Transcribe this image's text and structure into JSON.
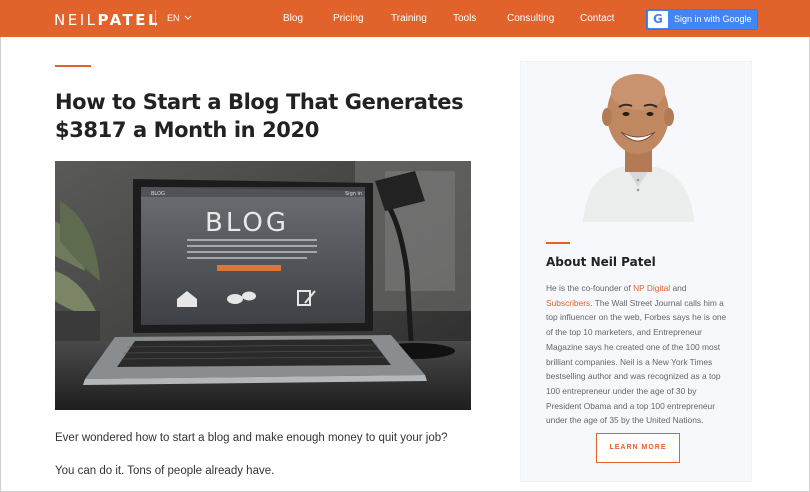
{
  "header": {
    "logo_part1": "NEIL",
    "logo_part2": "PATEL",
    "lang": "EN",
    "nav": [
      "Blog",
      "Pricing",
      "Training",
      "Tools",
      "Consulting",
      "Contact"
    ],
    "google_g": "G",
    "google_label": "Sign in with Google"
  },
  "article": {
    "title": "How to Start a Blog That Generates $3817 a Month in 2020",
    "hero": {
      "blog_word": "BLOG",
      "sign_in": "Sign in",
      "mini_logo": "BLOG"
    },
    "paragraphs": [
      "Ever wondered how to start a blog and make enough money to quit your job?",
      "You can do it. Tons of people already have."
    ]
  },
  "sidebar": {
    "title": "About Neil Patel",
    "bio_1": "He is the co-founder of ",
    "bio_link1": "NP Digital",
    "bio_2": " and ",
    "bio_link2": "Subscribers",
    "bio_3": ". The Wall Street Journal calls him a top influencer on the web, Forbes says he is one of the top 10 marketers, and Entrepreneur Magazine says he created one of the 100 most brilliant companies. Neil is a New York Times bestselling author and was recognized as a top 100 entrepreneur under the age of 30 by President Obama and a top 100 entrepreneur under the age of 35 by the United Nations.",
    "button": "LEARN MORE"
  },
  "colors": {
    "brand_orange": "#e2622c",
    "google_blue": "#4285f4"
  }
}
